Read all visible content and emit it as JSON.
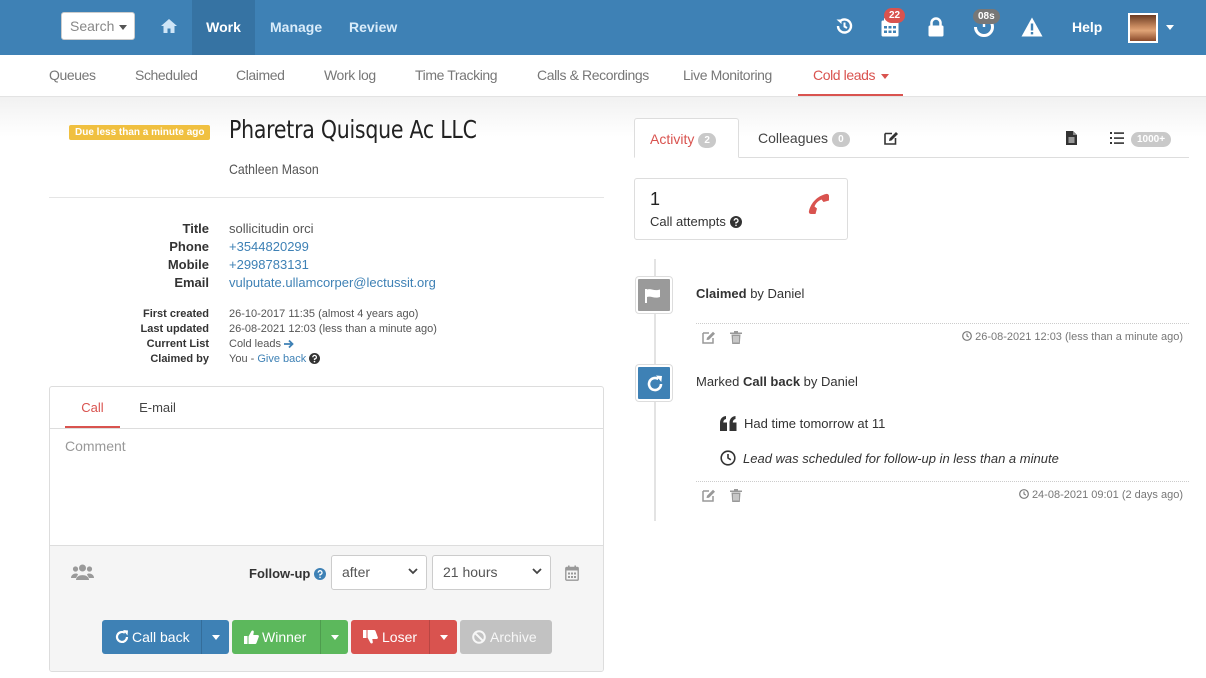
{
  "topbar": {
    "search_placeholder": "Search",
    "nav": {
      "work": "Work",
      "manage": "Manage",
      "review": "Review"
    },
    "calendar_badge": "22",
    "timer_badge": "08s",
    "help": "Help",
    "accent_color": "#3e81b5"
  },
  "subnav": {
    "items": [
      "Queues",
      "Scheduled",
      "Claimed",
      "Work log",
      "Time Tracking",
      "Calls & Recordings",
      "Live Monitoring",
      "Cold leads"
    ],
    "active": "Cold leads"
  },
  "lead": {
    "due_badge": "Due less than a minute ago",
    "company": "Pharetra Quisque Ac LLC",
    "contact": "Cathleen Mason",
    "details": {
      "title_label": "Title",
      "title_value": "sollicitudin orci",
      "phone_label": "Phone",
      "phone_value": "+3544820299",
      "mobile_label": "Mobile",
      "mobile_value": "+2998783131",
      "email_label": "Email",
      "email_value": "vulputate.ullamcorper@lectussit.org",
      "first_created_label": "First created",
      "first_created_value": "26-10-2017 11:35 (almost 4 years ago)",
      "last_updated_label": "Last updated",
      "last_updated_value": "26-08-2021 12:03 (less than a minute ago)",
      "current_list_label": "Current List",
      "current_list_value": "Cold leads",
      "claimed_by_label": "Claimed by",
      "claimed_by_value": "You - ",
      "give_back": "Give back"
    }
  },
  "compose": {
    "tabs": [
      "Call",
      "E-mail"
    ],
    "active_tab": "Call",
    "comment_placeholder": "Comment",
    "followup_label": "Follow-up",
    "followup_mode": "after",
    "followup_amount": "21 hours",
    "buttons": {
      "callback": "Call back",
      "winner": "Winner",
      "loser": "Loser",
      "archive": "Archive"
    }
  },
  "activity": {
    "tabs": {
      "activity": "Activity",
      "activity_count": "2",
      "colleagues": "Colleagues",
      "colleagues_count": "0",
      "list_count": "1000+"
    },
    "attempts": {
      "count": "1",
      "label": "Call attempts"
    },
    "events": [
      {
        "bold": "Claimed",
        "rest": " by Daniel",
        "time": "26-08-2021 12:03 (less than a minute ago)"
      },
      {
        "prefix": "Marked ",
        "bold": "Call back",
        "rest": " by Daniel",
        "quote": "Had time tomorrow at 11",
        "note": "Lead was scheduled for follow-up in less than a minute",
        "time": "24-08-2021 09:01 (2 days ago)"
      }
    ]
  }
}
